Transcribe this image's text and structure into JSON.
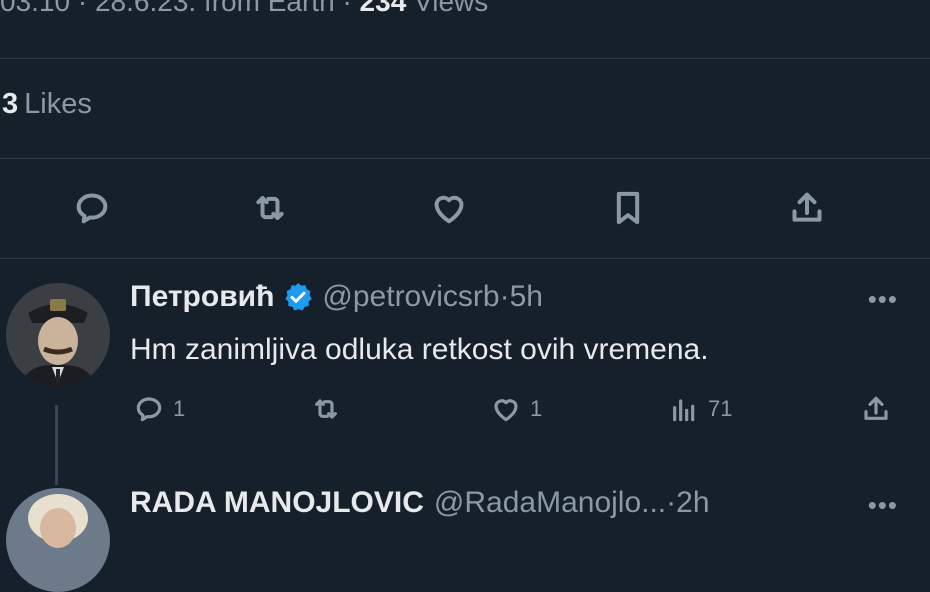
{
  "tweet_meta": {
    "time": "03:10",
    "date": "28.6.23.",
    "source": "from Earth",
    "views_count": "234",
    "views_label": "Views",
    "separator": "·"
  },
  "likes": {
    "count": "3",
    "label": "Likes"
  },
  "main_actions": [
    {
      "icon": "reply-icon"
    },
    {
      "icon": "retweet-icon"
    },
    {
      "icon": "like-icon"
    },
    {
      "icon": "bookmark-icon"
    },
    {
      "icon": "share-icon"
    }
  ],
  "replies": [
    {
      "name": "Петровић",
      "verified": true,
      "handle": "@petrovicsrb",
      "time": "5h",
      "separator": "·",
      "text": "Hm zanimljiva odluka retkost ovih vremena.",
      "reply_count": "1",
      "retweet_count": "",
      "like_count": "1",
      "view_count": "71",
      "more_icon": "more-icon"
    },
    {
      "name": "RADA MANOJLOVIC",
      "handle": "@RadaManojlo...",
      "time": "2h",
      "separator": "·",
      "more_icon": "more-icon"
    }
  ],
  "colors": {
    "background": "#15202b",
    "text_primary": "#e7e9ea",
    "text_secondary": "#8b98a5",
    "verified_badge": "#1d9bf0",
    "divider": "#2f3942"
  }
}
